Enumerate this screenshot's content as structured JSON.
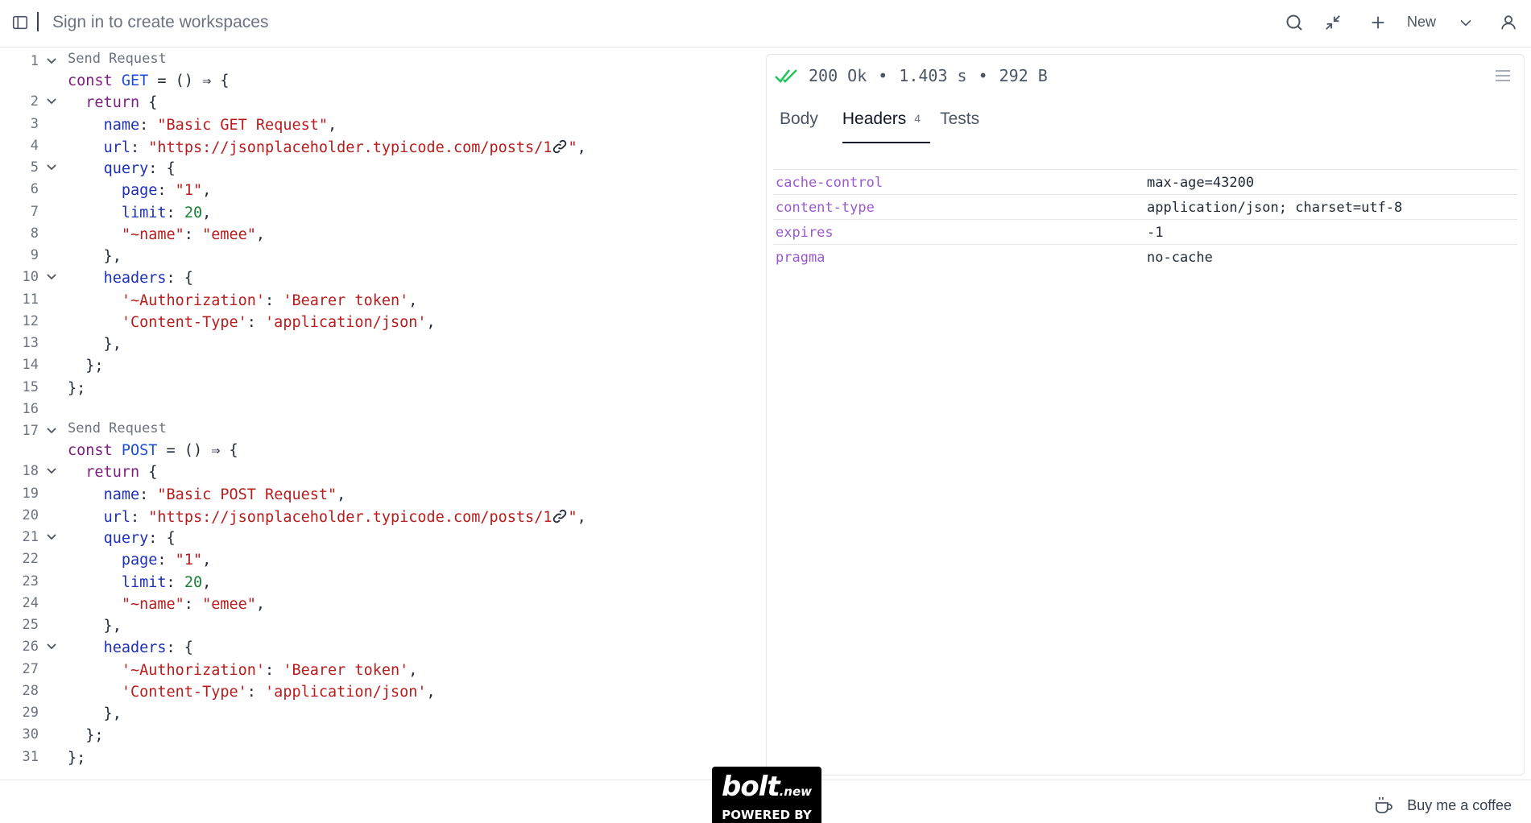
{
  "topbar": {
    "title": "Sign in to create workspaces",
    "new_label": "New",
    "icons": [
      "sidebar-toggle-icon",
      "search-icon",
      "collapse-icon",
      "plus-icon",
      "chevron-down-icon",
      "user-icon"
    ]
  },
  "editor": {
    "lens_label": "Send Request",
    "lines": [
      {
        "n": "1",
        "fold": true,
        "lens": true,
        "tokens": [
          [
            "kw",
            "const "
          ],
          [
            "fn",
            "GET"
          ],
          [
            "pl",
            " = () ⇒ {"
          ]
        ]
      },
      {
        "n": "2",
        "fold": true,
        "tokens": [
          [
            "pl",
            "  "
          ],
          [
            "kw",
            "return"
          ],
          [
            "pl",
            " {"
          ]
        ]
      },
      {
        "n": "3",
        "tokens": [
          [
            "pl",
            "    "
          ],
          [
            "prop",
            "name"
          ],
          [
            "pl",
            ": "
          ],
          [
            "str",
            "\"Basic GET Request\""
          ],
          [
            "pl",
            ","
          ]
        ]
      },
      {
        "n": "4",
        "link": true,
        "tokens": [
          [
            "pl",
            "    "
          ],
          [
            "prop",
            "url"
          ],
          [
            "pl",
            ": "
          ],
          [
            "str",
            "\"https://jsonplaceholder.typicode.com/posts/1"
          ]
        ],
        "tail": [
          [
            "str",
            "\""
          ],
          [
            "pl",
            ","
          ]
        ]
      },
      {
        "n": "5",
        "fold": true,
        "tokens": [
          [
            "pl",
            "    "
          ],
          [
            "prop",
            "query"
          ],
          [
            "pl",
            ": {"
          ]
        ]
      },
      {
        "n": "6",
        "tokens": [
          [
            "pl",
            "      "
          ],
          [
            "prop",
            "page"
          ],
          [
            "pl",
            ": "
          ],
          [
            "str",
            "\"1\""
          ],
          [
            "pl",
            ","
          ]
        ]
      },
      {
        "n": "7",
        "tokens": [
          [
            "pl",
            "      "
          ],
          [
            "prop",
            "limit"
          ],
          [
            "pl",
            ": "
          ],
          [
            "num",
            "20"
          ],
          [
            "pl",
            ","
          ]
        ]
      },
      {
        "n": "8",
        "tokens": [
          [
            "pl",
            "      "
          ],
          [
            "str",
            "\"~name\""
          ],
          [
            "pl",
            ": "
          ],
          [
            "str",
            "\"emee\""
          ],
          [
            "pl",
            ","
          ]
        ]
      },
      {
        "n": "9",
        "tokens": [
          [
            "pl",
            "    },"
          ]
        ]
      },
      {
        "n": "10",
        "fold": true,
        "tokens": [
          [
            "pl",
            "    "
          ],
          [
            "prop",
            "headers"
          ],
          [
            "pl",
            ": {"
          ]
        ]
      },
      {
        "n": "11",
        "tokens": [
          [
            "pl",
            "      "
          ],
          [
            "str",
            "'~Authorization'"
          ],
          [
            "pl",
            ": "
          ],
          [
            "str",
            "'Bearer token'"
          ],
          [
            "pl",
            ","
          ]
        ]
      },
      {
        "n": "12",
        "tokens": [
          [
            "pl",
            "      "
          ],
          [
            "str",
            "'Content-Type'"
          ],
          [
            "pl",
            ": "
          ],
          [
            "str",
            "'application/json'"
          ],
          [
            "pl",
            ","
          ]
        ]
      },
      {
        "n": "13",
        "tokens": [
          [
            "pl",
            "    },"
          ]
        ]
      },
      {
        "n": "14",
        "tokens": [
          [
            "pl",
            "  };"
          ]
        ]
      },
      {
        "n": "15",
        "tokens": [
          [
            "pl",
            "};"
          ]
        ]
      },
      {
        "n": "16",
        "tokens": []
      },
      {
        "n": "17",
        "fold": true,
        "lens": true,
        "tokens": [
          [
            "kw",
            "const "
          ],
          [
            "fn",
            "POST"
          ],
          [
            "pl",
            " = () ⇒ {"
          ]
        ]
      },
      {
        "n": "18",
        "fold": true,
        "tokens": [
          [
            "pl",
            "  "
          ],
          [
            "kw",
            "return"
          ],
          [
            "pl",
            " {"
          ]
        ]
      },
      {
        "n": "19",
        "tokens": [
          [
            "pl",
            "    "
          ],
          [
            "prop",
            "name"
          ],
          [
            "pl",
            ": "
          ],
          [
            "str",
            "\"Basic POST Request\""
          ],
          [
            "pl",
            ","
          ]
        ]
      },
      {
        "n": "20",
        "link": true,
        "tokens": [
          [
            "pl",
            "    "
          ],
          [
            "prop",
            "url"
          ],
          [
            "pl",
            ": "
          ],
          [
            "str",
            "\"https://jsonplaceholder.typicode.com/posts/1"
          ]
        ],
        "tail": [
          [
            "str",
            "\""
          ],
          [
            "pl",
            ","
          ]
        ]
      },
      {
        "n": "21",
        "fold": true,
        "tokens": [
          [
            "pl",
            "    "
          ],
          [
            "prop",
            "query"
          ],
          [
            "pl",
            ": {"
          ]
        ]
      },
      {
        "n": "22",
        "tokens": [
          [
            "pl",
            "      "
          ],
          [
            "prop",
            "page"
          ],
          [
            "pl",
            ": "
          ],
          [
            "str",
            "\"1\""
          ],
          [
            "pl",
            ","
          ]
        ]
      },
      {
        "n": "23",
        "tokens": [
          [
            "pl",
            "      "
          ],
          [
            "prop",
            "limit"
          ],
          [
            "pl",
            ": "
          ],
          [
            "num",
            "20"
          ],
          [
            "pl",
            ","
          ]
        ]
      },
      {
        "n": "24",
        "tokens": [
          [
            "pl",
            "      "
          ],
          [
            "str",
            "\"~name\""
          ],
          [
            "pl",
            ": "
          ],
          [
            "str",
            "\"emee\""
          ],
          [
            "pl",
            ","
          ]
        ]
      },
      {
        "n": "25",
        "tokens": [
          [
            "pl",
            "    },"
          ]
        ]
      },
      {
        "n": "26",
        "fold": true,
        "tokens": [
          [
            "pl",
            "    "
          ],
          [
            "prop",
            "headers"
          ],
          [
            "pl",
            ": {"
          ]
        ]
      },
      {
        "n": "27",
        "tokens": [
          [
            "pl",
            "      "
          ],
          [
            "str",
            "'~Authorization'"
          ],
          [
            "pl",
            ": "
          ],
          [
            "str",
            "'Bearer token'"
          ],
          [
            "pl",
            ","
          ]
        ]
      },
      {
        "n": "28",
        "tokens": [
          [
            "pl",
            "      "
          ],
          [
            "str",
            "'Content-Type'"
          ],
          [
            "pl",
            ": "
          ],
          [
            "str",
            "'application/json'"
          ],
          [
            "pl",
            ","
          ]
        ]
      },
      {
        "n": "29",
        "tokens": [
          [
            "pl",
            "    },"
          ]
        ]
      },
      {
        "n": "30",
        "tokens": [
          [
            "pl",
            "  };"
          ]
        ]
      },
      {
        "n": "31",
        "tokens": [
          [
            "pl",
            "};"
          ]
        ]
      }
    ]
  },
  "response": {
    "status_code": "200 Ok",
    "time": "1.403 s",
    "size": "292 B",
    "separator": "•",
    "tabs": [
      {
        "label": "Body",
        "badge": "",
        "active": false
      },
      {
        "label": "Headers",
        "badge": "4",
        "active": true
      },
      {
        "label": "Tests",
        "badge": "",
        "active": false
      }
    ],
    "headers": [
      {
        "key": "cache-control",
        "value": "max-age=43200"
      },
      {
        "key": "content-type",
        "value": "application/json; charset=utf-8"
      },
      {
        "key": "expires",
        "value": "-1"
      },
      {
        "key": "pragma",
        "value": "no-cache"
      }
    ]
  },
  "footer": {
    "coffee_label": "Buy me a coffee",
    "badge_logo": "bolt",
    "badge_logo_suffix": ".new",
    "badge_text": "POWERED BY"
  },
  "colors": {
    "keyword": "#7c1d7f",
    "function": "#1d4ed8",
    "property": "#1e2fb8",
    "string": "#b91c1c",
    "number": "#1a7f37",
    "header_key": "#9b59d0",
    "status_ok": "#22c55e"
  }
}
